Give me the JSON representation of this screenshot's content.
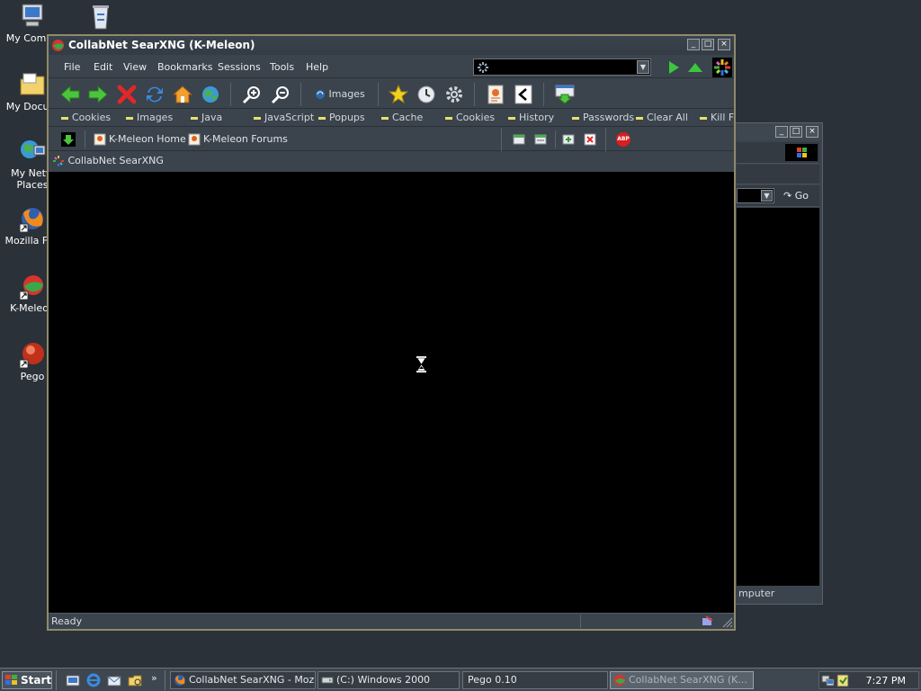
{
  "desktop": {
    "icons": [
      {
        "label": "My Compu"
      },
      {
        "label": ""
      },
      {
        "label": "My Docum"
      },
      {
        "label": "My Netw"
      },
      {
        "label": "Places"
      },
      {
        "label": "Mozilla Fire"
      },
      {
        "label": "K-Meleon"
      },
      {
        "label": "Pego"
      }
    ]
  },
  "window": {
    "title": "CollabNet SearXNG (K-Meleon)",
    "menu": [
      "File",
      "Edit",
      "View",
      "Bookmarks",
      "Sessions",
      "Tools",
      "Help"
    ],
    "toolbar": {
      "images_label": "Images"
    },
    "prefbar": [
      "Cookies",
      "Images",
      "Java",
      "JavaScript",
      "Popups",
      "Cache",
      "Cookies",
      "History",
      "Passwords",
      "Clear All",
      "Kill Fl"
    ],
    "bookmarks": [
      "K-Meleon Home",
      "K-Meleon Forums"
    ],
    "tab_title": "CollabNet SearXNG",
    "status": "Ready",
    "adblock_label": "ABP"
  },
  "bg_window": {
    "go_label": "Go",
    "status_fragment": "mputer"
  },
  "taskbar": {
    "start_label": "Start",
    "tasks": [
      "CollabNet SearXNG - Mozil...",
      "(C:) Windows 2000",
      "Pego 0.10",
      "CollabNet SearXNG (K..."
    ],
    "clock": "7:27 PM"
  },
  "colors": {
    "desktop": "#2b3138",
    "content": "#000000",
    "frame": "#3b434c"
  }
}
